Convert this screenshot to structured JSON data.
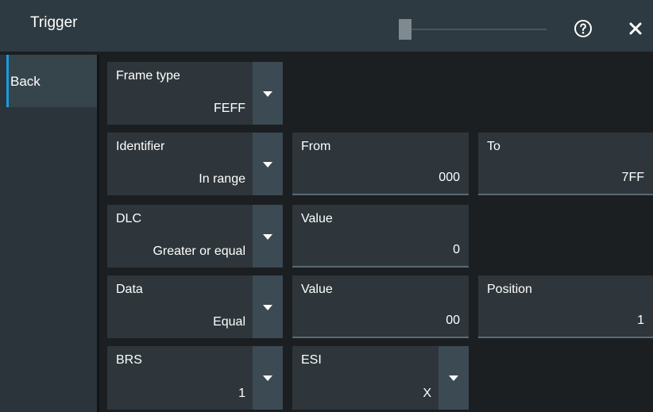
{
  "window": {
    "title": "Trigger"
  },
  "sidebar": {
    "back_label": "Back"
  },
  "rows": {
    "frame_type": {
      "label": "Frame type",
      "value": "FEFF"
    },
    "identifier": {
      "label": "Identifier",
      "value": "In range",
      "from_label": "From",
      "from_value": "000",
      "to_label": "To",
      "to_value": "7FF"
    },
    "dlc": {
      "label": "DLC",
      "value": "Greater or equal",
      "value_label": "Value",
      "value_value": "0"
    },
    "data": {
      "label": "Data",
      "value": "Equal",
      "value_label": "Value",
      "value_value": "00",
      "position_label": "Position",
      "position_value": "1"
    },
    "brs": {
      "label": "BRS",
      "value": "1"
    },
    "esi": {
      "label": "ESI",
      "value": "X"
    }
  },
  "icons": {
    "help": "help-circle-icon",
    "close": "close-icon",
    "dropdown": "triangle-down-icon"
  },
  "colors": {
    "accent": "#1b9be0",
    "titlebar": "#2e3a41",
    "panel": "#2e363b",
    "background": "#1b1f22"
  }
}
